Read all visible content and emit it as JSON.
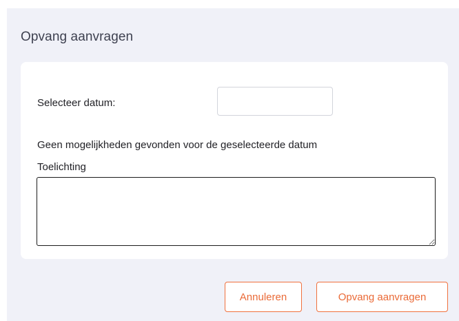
{
  "dialog": {
    "title": "Opvang aanvragen",
    "date_label": "Selecteer datum:",
    "date_value": "",
    "message": "Geen mogelijkheden gevonden voor de geselecteerde datum",
    "note_label": "Toelichting",
    "note_value": ""
  },
  "actions": {
    "cancel_label": "Annuleren",
    "submit_label": "Opvang aanvragen"
  },
  "colors": {
    "accent": "#f0703c",
    "panel_background": "#f0f1f8"
  }
}
